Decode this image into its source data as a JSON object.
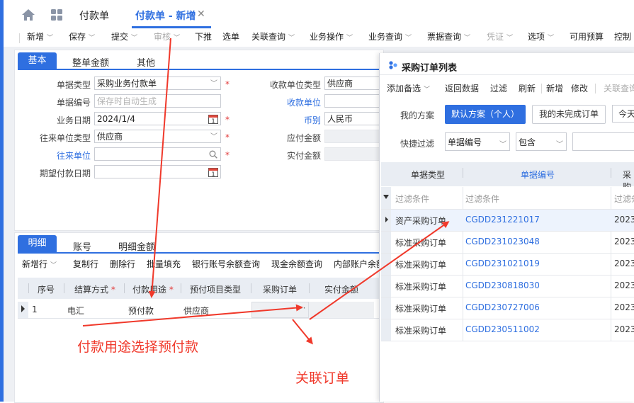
{
  "top": {
    "tab_1": "付款单",
    "tab_2": "付款单 - 新增",
    "close": "✕"
  },
  "toolbar": {
    "items": [
      "新增",
      "保存",
      "提交",
      "审核",
      "下推",
      "选单",
      "关联查询",
      "业务操作",
      "业务查询",
      "票据查询",
      "凭证",
      "选项",
      "可用预算",
      "控制"
    ]
  },
  "header_tabs": [
    "基本",
    "整单金额",
    "其他"
  ],
  "form": {
    "doc_type_label": "单据类型",
    "doc_type_value": "采购业务付款单",
    "doc_no_label": "单据编号",
    "doc_no_placeholder": "保存时自动生成",
    "biz_date_label": "业务日期",
    "biz_date_value": "2024/1/4",
    "contact_type_label": "往来单位类型",
    "contact_type_value": "供应商",
    "contact_label": "往来单位",
    "exp_date_label": "期望付款日期",
    "payee_type_label": "收款单位类型",
    "payee_type_value": "供应商",
    "payee_label": "收款单位",
    "currency_label": "币别",
    "currency_value": "人民币",
    "payable_label": "应付金额",
    "actual_label": "实付金额",
    "calendar_day": "1"
  },
  "detail_tabs": [
    "明细",
    "账号",
    "明细金额"
  ],
  "detail_toolbar": [
    "新增行",
    "复制行",
    "删除行",
    "批量填充",
    "银行账号余额查询",
    "现金余额查询",
    "内部账户余额"
  ],
  "detail_grid": {
    "headers": [
      "序号",
      "结算方式",
      "付款用途",
      "预付项目类型",
      "采购订单",
      "实付金额"
    ],
    "row": {
      "seq": "1",
      "method": "电汇",
      "purpose": "预付款",
      "prepay_type": "供应商",
      "more": "···"
    }
  },
  "dialog": {
    "title": "采购订单列表",
    "toolbar": [
      "添加备选",
      "返回数据",
      "过滤",
      "刷新",
      "新增",
      "修改",
      "关联查询"
    ],
    "scheme_label": "我的方案",
    "schemes": [
      "默认方案（个人）",
      "我的未完成订单",
      "今天"
    ],
    "filter_label": "快捷过滤",
    "filter_field": "单据编号",
    "filter_op": "包含",
    "headers": [
      "单据类型",
      "单据编号",
      "采购"
    ],
    "filter_row": [
      "过滤条件",
      "过滤条件",
      "过滤条"
    ],
    "rows": [
      {
        "type": "资产采购订单",
        "code": "CGDD231221017",
        "date": "2023"
      },
      {
        "type": "标准采购订单",
        "code": "CGDD231023048",
        "date": "2023"
      },
      {
        "type": "标准采购订单",
        "code": "CGDD231021019",
        "date": "2023"
      },
      {
        "type": "标准采购订单",
        "code": "CGDD230818030",
        "date": "2023"
      },
      {
        "type": "标准采购订单",
        "code": "CGDD230727006",
        "date": "2023"
      },
      {
        "type": "标准采购订单",
        "code": "CGDD230511002",
        "date": "2023"
      }
    ]
  },
  "annotations": {
    "note_1": "付款用途选择预付款",
    "note_2": "关联订单"
  },
  "colors": {
    "accent": "#2f6fe0",
    "annotation": "#f0392b"
  }
}
